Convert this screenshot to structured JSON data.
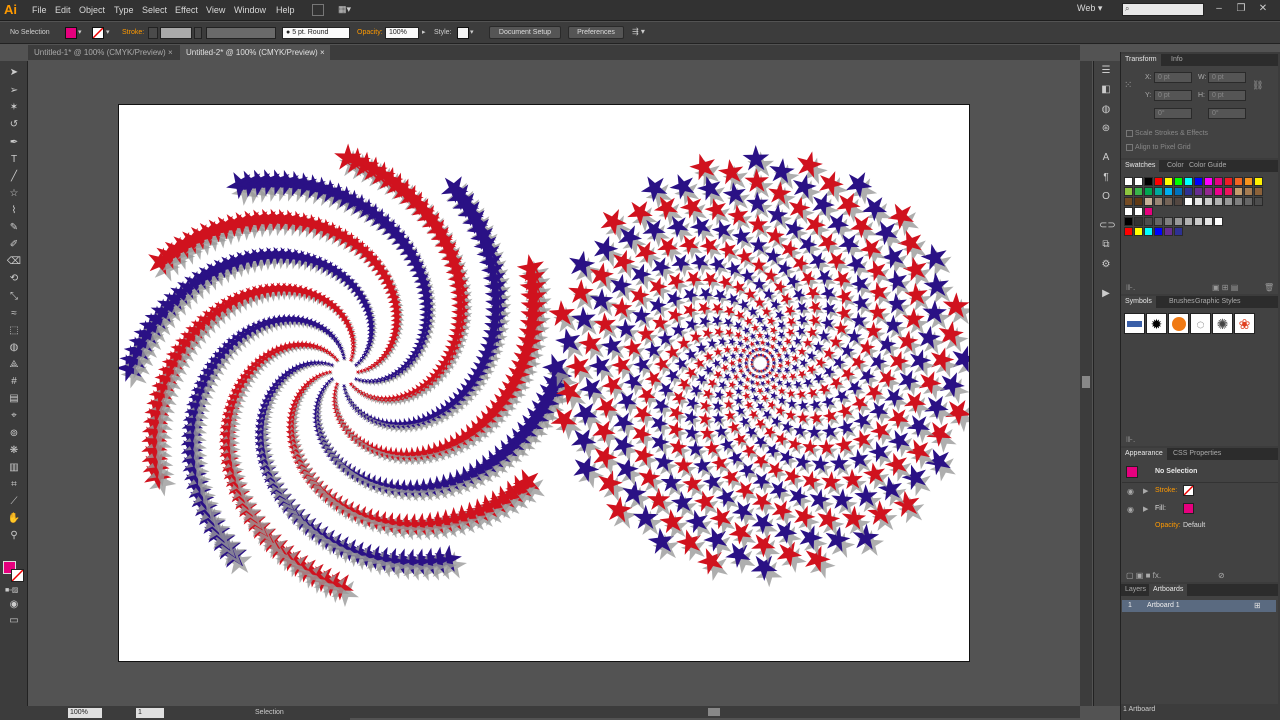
{
  "app": {
    "logo": "Ai"
  },
  "menu": [
    "File",
    "Edit",
    "Object",
    "Type",
    "Select",
    "Effect",
    "View",
    "Window",
    "Help"
  ],
  "workspace": "Web",
  "control_bar": {
    "selection_label": "No Selection",
    "fill_color": "#e6007e",
    "stroke_label": "Stroke:",
    "brush_label": "5 pt. Round",
    "opacity_label": "Opacity:",
    "opacity_value": "100%",
    "style_label": "Style:",
    "document_setup": "Document Setup",
    "preferences": "Preferences"
  },
  "tabs": [
    {
      "label": "Untitled-1* @ 100% (CMYK/Preview)",
      "active": false
    },
    {
      "label": "Untitled-2* @ 100% (CMYK/Preview)",
      "active": true
    }
  ],
  "colors": {
    "red": "#d0121e",
    "blue": "#2a1185",
    "shadow": "#9a9a9a"
  },
  "tools": [
    "selection-tool",
    "direct-selection-tool",
    "magic-wand-tool",
    "lasso-tool",
    "pen-tool",
    "type-tool",
    "line-tool",
    "star-tool",
    "paintbrush-tool",
    "pencil-tool",
    "blob-brush-tool",
    "eraser-tool",
    "rotate-tool",
    "scale-tool",
    "warp-tool",
    "free-transform-tool",
    "shape-builder-tool",
    "perspective-grid-tool",
    "mesh-tool",
    "gradient-tool",
    "eyedropper-tool",
    "blend-tool",
    "symbol-sprayer-tool",
    "column-graph-tool",
    "artboard-tool",
    "slice-tool",
    "hand-tool",
    "zoom-tool"
  ],
  "transform_panel": {
    "tabs": [
      "Transform",
      "Info"
    ],
    "x_label": "X:",
    "x_value": "0 pt",
    "w_label": "W:",
    "w_value": "0 pt",
    "y_label": "Y:",
    "y_value": "0 pt",
    "h_label": "H:",
    "h_value": "0 pt",
    "angle": "0°",
    "shear": "0°",
    "scale_strokes": "Scale Strokes & Effects",
    "align_pixel": "Align to Pixel Grid"
  },
  "swatches_panel": {
    "tabs": [
      "Swatches",
      "Color",
      "Color Guide"
    ]
  },
  "symbols_panel": {
    "tabs": [
      "Symbols",
      "Brushes",
      "Graphic Styles"
    ]
  },
  "appearance_panel": {
    "tabs": [
      "Appearance",
      "CSS Properties"
    ],
    "title": "No Selection",
    "stroke_label": "Stroke:",
    "fill_label": "Fill:",
    "opacity_label": "Opacity:",
    "opacity_value": "Default"
  },
  "layers_panel": {
    "tabs": [
      "Layers",
      "Artboards"
    ],
    "rows": [
      {
        "num": "1",
        "name": "Artboard 1"
      }
    ],
    "footer": "1 Artboard"
  },
  "status_bar": {
    "zoom": "100%",
    "page": "1",
    "mode": "Selection"
  }
}
